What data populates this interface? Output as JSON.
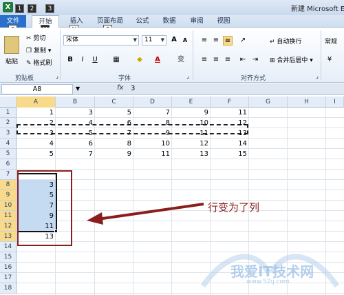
{
  "title_bar": {
    "app_title": "新建 Microsoft E",
    "logo": "X",
    "qat_keys": [
      "1",
      "2",
      "3"
    ]
  },
  "tabs": [
    {
      "label": "文件",
      "key": "F"
    },
    {
      "label": "开始",
      "key": "H"
    },
    {
      "label": "插入",
      "key": "N"
    },
    {
      "label": "页面布局",
      "key": "P"
    },
    {
      "label": "公式",
      "key": ""
    },
    {
      "label": "数据",
      "key": ""
    },
    {
      "label": "审阅",
      "key": ""
    },
    {
      "label": "视图",
      "key": ""
    }
  ],
  "ribbon": {
    "clipboard": {
      "paste": "粘贴",
      "cut": "剪切",
      "copy": "复制 ▾",
      "format_painter": "格式刷",
      "group_label": "剪贴板"
    },
    "font": {
      "font_name": "宋体",
      "font_size": "11",
      "group_label": "字体",
      "bold": "B",
      "italic": "I",
      "underline": "U",
      "phonetic": "变"
    },
    "alignment": {
      "wrap_text": "自动换行",
      "merge_center": "合并后居中 ▾",
      "group_label": "对齐方式"
    },
    "number": {
      "format": "常规"
    }
  },
  "formula_bar": {
    "name_box": "A8",
    "fx": "fx",
    "value": "3"
  },
  "columns": [
    "A",
    "B",
    "C",
    "D",
    "E",
    "F",
    "G",
    "H",
    "I"
  ],
  "rows": [
    "1",
    "2",
    "3",
    "4",
    "5",
    "6",
    "7",
    "8",
    "9",
    "10",
    "11",
    "12",
    "13",
    "14",
    "15",
    "16",
    "17",
    "18"
  ],
  "cells": {
    "r1": [
      "1",
      "3",
      "5",
      "7",
      "9",
      "11"
    ],
    "r2": [
      "2",
      "4",
      "6",
      "8",
      "10",
      "12"
    ],
    "r3": [
      "3",
      "5",
      "7",
      "9",
      "11",
      "13"
    ],
    "r4": [
      "4",
      "6",
      "8",
      "10",
      "12",
      "14"
    ],
    "r5": [
      "5",
      "7",
      "9",
      "11",
      "13",
      "15"
    ],
    "colA": [
      "3",
      "5",
      "7",
      "9",
      "11",
      "13"
    ]
  },
  "annotation": "行变为了列",
  "watermark": {
    "text": "我爱IT技术网",
    "url": "www.52ij.com"
  },
  "colors": {
    "annotation_red": "#8a1e1e",
    "selection_blue": "#c5dbf2",
    "header_highlight": "#f9d98a",
    "file_tab": "#2a6fc9"
  }
}
